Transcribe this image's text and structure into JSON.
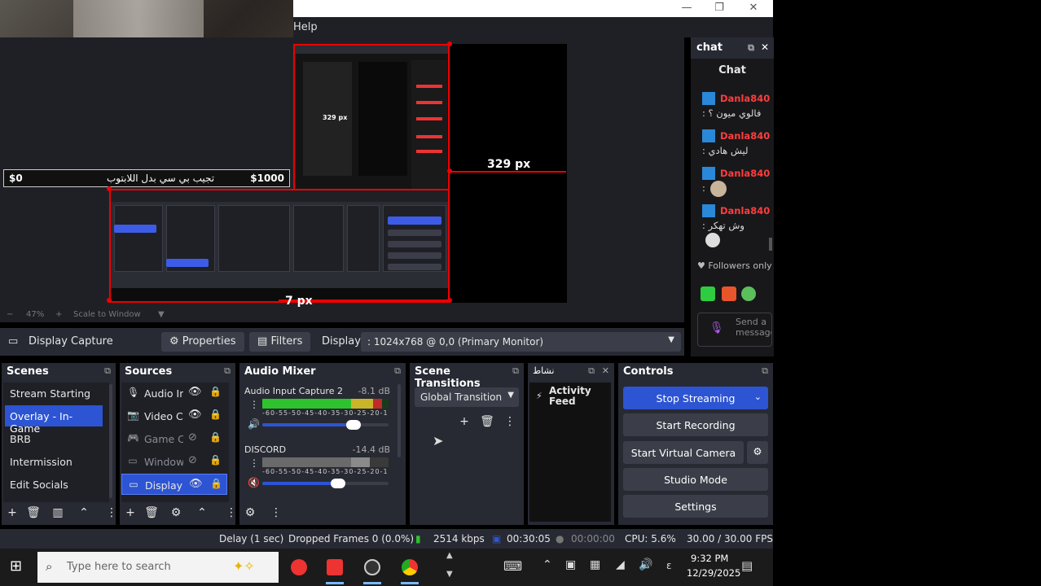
{
  "window": {
    "menu_help": "Help",
    "minimize": "—",
    "restore": "❐",
    "close": "✕"
  },
  "preview": {
    "measure_width": "329 px",
    "measure_offset": "7 px",
    "ticker_left": "$0",
    "ticker_middle": "تجيب بي سي بدل اللابتوب",
    "ticker_right": "$1000",
    "zoom_minus": "−",
    "zoom_level": "47%",
    "zoom_plus": "+",
    "zoom_mode": "Scale to Window"
  },
  "context_bar": {
    "source_name": "Display Capture",
    "properties_label": "Properties",
    "filters_label": "Filters",
    "display_label": "Display",
    "display_value": ": 1024x768 @ 0,0 (Primary Monitor)"
  },
  "scenes": {
    "title": "Scenes",
    "items": [
      {
        "label": "Stream Starting"
      },
      {
        "label": "Overlay - In-Game"
      },
      {
        "label": "BRB"
      },
      {
        "label": "Intermission"
      },
      {
        "label": "Edit Socials"
      }
    ]
  },
  "sources": {
    "title": "Sources",
    "items": [
      {
        "label": "Audio In",
        "icon": "mic-icon"
      },
      {
        "label": "Video Ca",
        "icon": "camera-icon"
      },
      {
        "label": "Game Ca",
        "icon": "gamepad-icon"
      },
      {
        "label": "Window",
        "icon": "window-icon"
      },
      {
        "label": "Display C",
        "icon": "monitor-icon"
      }
    ]
  },
  "audio_mixer": {
    "title": "Audio Mixer",
    "channels": [
      {
        "name": "Audio Input Capture 2",
        "db": "-8.1 dB",
        "level": 0.95,
        "volume": 0.72
      },
      {
        "name": "DISCORD",
        "db": "-14.4 dB",
        "level": 0.85,
        "volume": 0.6
      }
    ],
    "ticks": "-60-55-50-45-40-35-30-25-20-15-10 -5 0"
  },
  "scene_transitions": {
    "title": "Scene Transitions",
    "selected": "Global Transition"
  },
  "activity": {
    "title_tab": "نشاط",
    "feed_title": "Activity Feed"
  },
  "controls": {
    "title": "Controls",
    "stop_streaming": "Stop Streaming",
    "start_recording": "Start Recording",
    "start_virtual_camera": "Start Virtual Camera",
    "studio_mode": "Studio Mode",
    "settings": "Settings"
  },
  "chat": {
    "dock_title": "chat",
    "panel_title": "Chat",
    "messages": [
      {
        "user": "Danla840",
        "text": ": فالوي ميون ؟"
      },
      {
        "user": "Danla840",
        "text": ": ليش هادي"
      },
      {
        "user": "Danla840",
        "text": ":"
      },
      {
        "user": "Danla840",
        "text": ": وش تهكر"
      }
    ],
    "followers_only": "Followers only",
    "send_placeholder": "Send a message"
  },
  "status_bar": {
    "delay": "Delay (1 sec)",
    "dropped_frames": "Dropped Frames 0 (0.0%)",
    "bitrate": "2514 kbps",
    "stream_time": "00:30:05",
    "record_time": "00:00:00",
    "cpu": "CPU: 5.6%",
    "fps": "30.00 / 30.00 FPS"
  },
  "taskbar": {
    "search_placeholder": "Type here to search",
    "time": "9:32 PM",
    "date": "12/29/2025"
  },
  "colors": {
    "accent": "#2d54d3",
    "panel": "#272a33",
    "panel_dark": "#1f2026",
    "chat_user": "#ff3d3d",
    "selection_red": "#ee0000"
  }
}
